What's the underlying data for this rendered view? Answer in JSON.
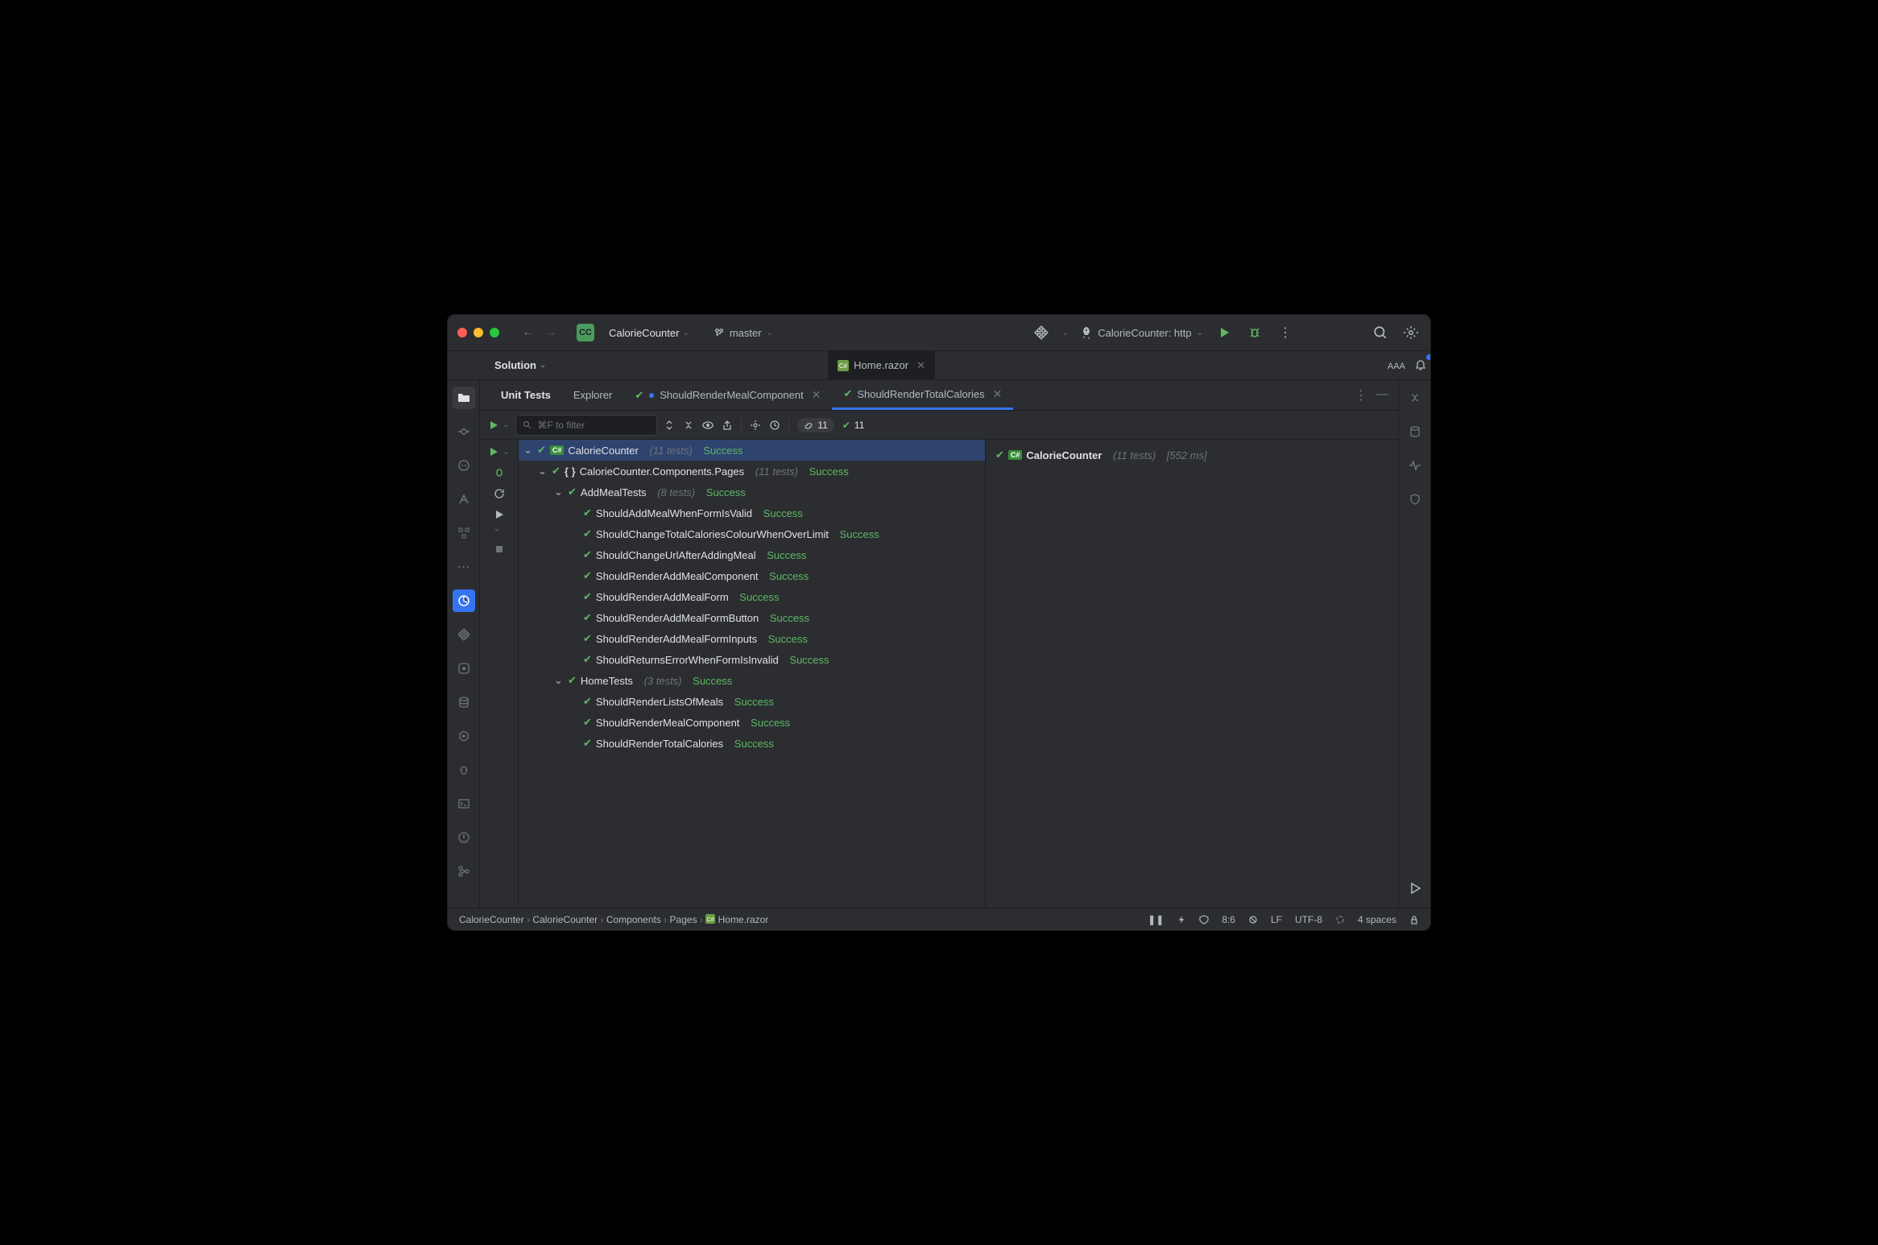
{
  "titlebar": {
    "project": "CalorieCounter",
    "project_badge": "CC",
    "branch": "master",
    "run_config": "CalorieCounter: http"
  },
  "solution_label": "Solution",
  "editor_tab": {
    "label": "Home.razor"
  },
  "tool_tabs": {
    "unit_tests": "Unit Tests",
    "explorer": "Explorer",
    "tab1": "ShouldRenderMealComponent",
    "tab2": "ShouldRenderTotalCalories"
  },
  "filter_placeholder": "⌘F to filter",
  "counts": {
    "total": "11",
    "passed": "11"
  },
  "tree": {
    "root": {
      "name": "CalorieCounter",
      "meta": "(11 tests)",
      "status": "Success"
    },
    "ns": {
      "name": "CalorieCounter.Components.Pages",
      "meta": "(11 tests)",
      "status": "Success"
    },
    "g1": {
      "name": "AddMealTests",
      "meta": "(8 tests)",
      "status": "Success"
    },
    "g1_tests": [
      {
        "name": "ShouldAddMealWhenFormIsValid",
        "status": "Success"
      },
      {
        "name": "ShouldChangeTotalCaloriesColourWhenOverLimit",
        "status": "Success"
      },
      {
        "name": "ShouldChangeUrlAfterAddingMeal",
        "status": "Success"
      },
      {
        "name": "ShouldRenderAddMealComponent",
        "status": "Success"
      },
      {
        "name": "ShouldRenderAddMealForm",
        "status": "Success"
      },
      {
        "name": "ShouldRenderAddMealFormButton",
        "status": "Success"
      },
      {
        "name": "ShouldRenderAddMealFormInputs",
        "status": "Success"
      },
      {
        "name": "ShouldReturnsErrorWhenFormIsInvalid",
        "status": "Success"
      }
    ],
    "g2": {
      "name": "HomeTests",
      "meta": "(3 tests)",
      "status": "Success"
    },
    "g2_tests": [
      {
        "name": "ShouldRenderListsOfMeals",
        "status": "Success"
      },
      {
        "name": "ShouldRenderMealComponent",
        "status": "Success"
      },
      {
        "name": "ShouldRenderTotalCalories",
        "status": "Success"
      }
    ]
  },
  "output": {
    "name": "CalorieCounter",
    "meta": "(11 tests)",
    "time": "[552 ms]"
  },
  "breadcrumb": [
    "CalorieCounter",
    "CalorieCounter",
    "Components",
    "Pages",
    "Home.razor"
  ],
  "status": {
    "pos": "8:6",
    "eol": "LF",
    "enc": "UTF-8",
    "indent": "4 spaces"
  }
}
